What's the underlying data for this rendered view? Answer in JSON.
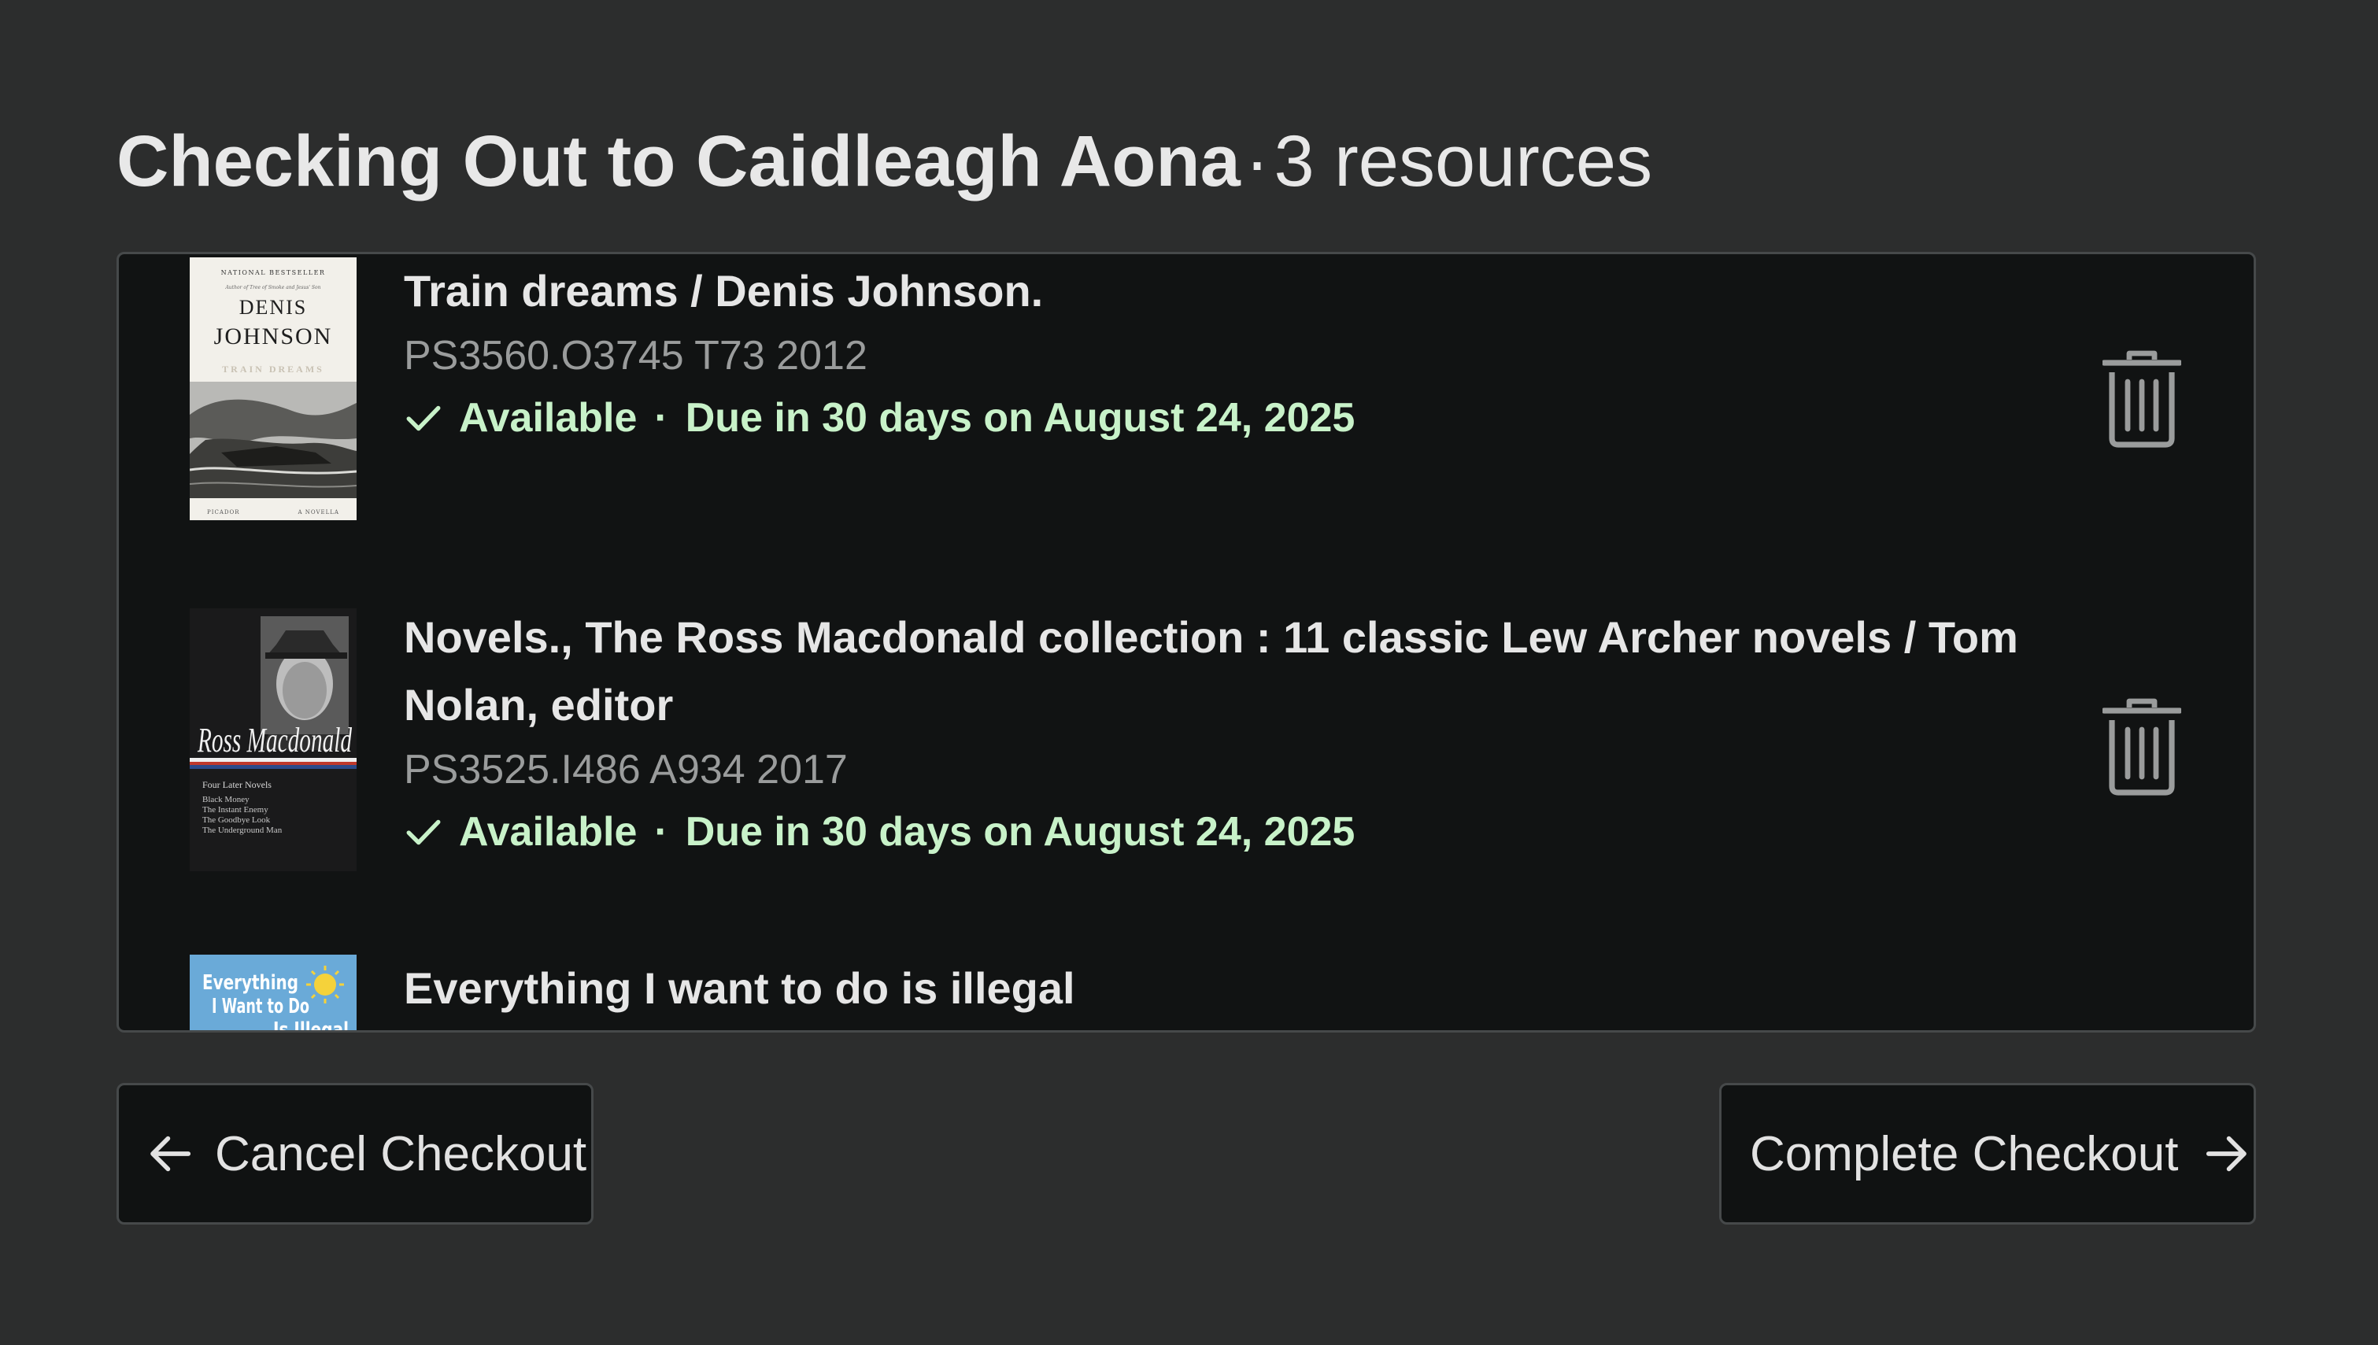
{
  "header": {
    "title_prefix": "Checking Out to Caidleagh Aona",
    "separator": "·",
    "resource_count": "3 resources"
  },
  "resources": [
    {
      "title": "Train dreams / Denis Johnson.",
      "call_number": "PS3560.O3745 T73 2012",
      "status": "Available",
      "due": "Due in 30 days on August 24, 2025",
      "cover_text": {
        "top": "NATIONAL BESTSELLER",
        "tagline": "Author of Tree of Smoke and Jesus' Son",
        "author_line1": "DENIS",
        "author_line2": "JOHNSON",
        "title": "TRAIN DREAMS",
        "footer_left": "PICADOR",
        "footer_right": "A NOVELLA"
      }
    },
    {
      "title": "Novels., The Ross Macdonald collection : 11 classic Lew Archer novels / Tom Nolan, editor",
      "call_number": "PS3525.I486 A934 2017",
      "status": "Available",
      "due": "Due in 30 days on August 24, 2025",
      "cover_text": {
        "signature": "Ross Macdonald",
        "subtitle": "Four Later Novels",
        "novels": [
          "Black Money",
          "The Instant Enemy",
          "The Goodbye Look",
          "The Underground Man"
        ]
      }
    },
    {
      "title": "Everything I want to do is illegal",
      "cover_text": {
        "line1": "Everything",
        "line2": "I Want to Do",
        "line3": "Is Illegal"
      }
    }
  ],
  "actions": {
    "cancel_label": "Cancel Checkout",
    "complete_label": "Complete Checkout"
  },
  "icons": {
    "check": "check-icon",
    "trash": "trash-icon",
    "arrow_left": "arrow-left-icon",
    "arrow_right": "arrow-right-icon"
  },
  "colors": {
    "background": "#2c2d2d",
    "panel": "#111313",
    "available": "#c8f2c9",
    "muted": "#9a9c9c",
    "border": "#46494a"
  }
}
